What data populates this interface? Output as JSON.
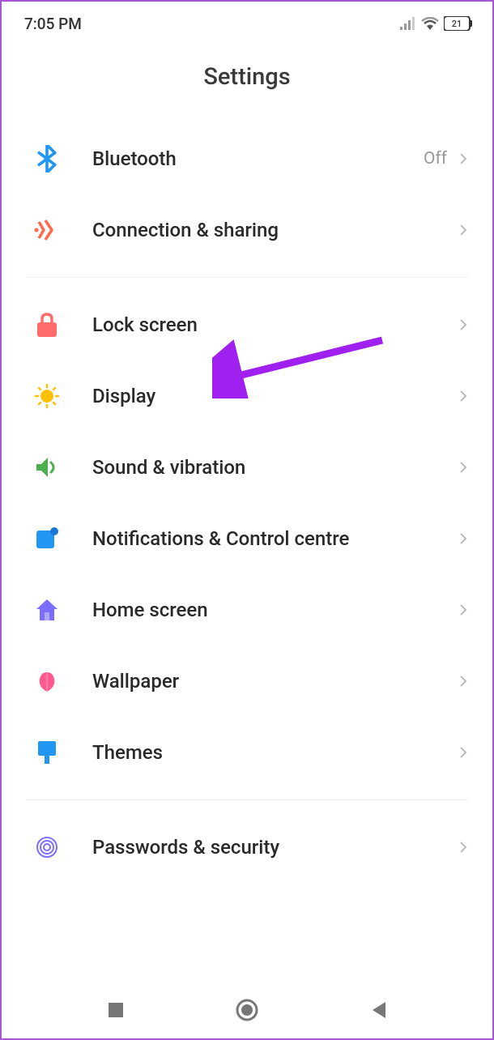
{
  "status": {
    "time": "7:05 PM",
    "battery": "21"
  },
  "page": {
    "title": "Settings"
  },
  "items": [
    {
      "id": "bluetooth",
      "label": "Bluetooth",
      "value": "Off",
      "color": "#2196f3"
    },
    {
      "id": "connection",
      "label": "Connection & sharing",
      "value": "",
      "color": "#ff6b4a"
    },
    {
      "id": "lockscreen",
      "label": "Lock screen",
      "value": "",
      "color": "#ff6b6b"
    },
    {
      "id": "display",
      "label": "Display",
      "value": "",
      "color": "#ffc107"
    },
    {
      "id": "sound",
      "label": "Sound & vibration",
      "value": "",
      "color": "#4caf50"
    },
    {
      "id": "notifications",
      "label": "Notifications & Control centre",
      "value": "",
      "color": "#2196f3"
    },
    {
      "id": "homescreen",
      "label": "Home screen",
      "value": "",
      "color": "#7c6fff"
    },
    {
      "id": "wallpaper",
      "label": "Wallpaper",
      "value": "",
      "color": "#ff5b8f"
    },
    {
      "id": "themes",
      "label": "Themes",
      "value": "",
      "color": "#2196f3"
    },
    {
      "id": "passwords",
      "label": "Passwords & security",
      "value": "",
      "color": "#7c6fff"
    }
  ]
}
